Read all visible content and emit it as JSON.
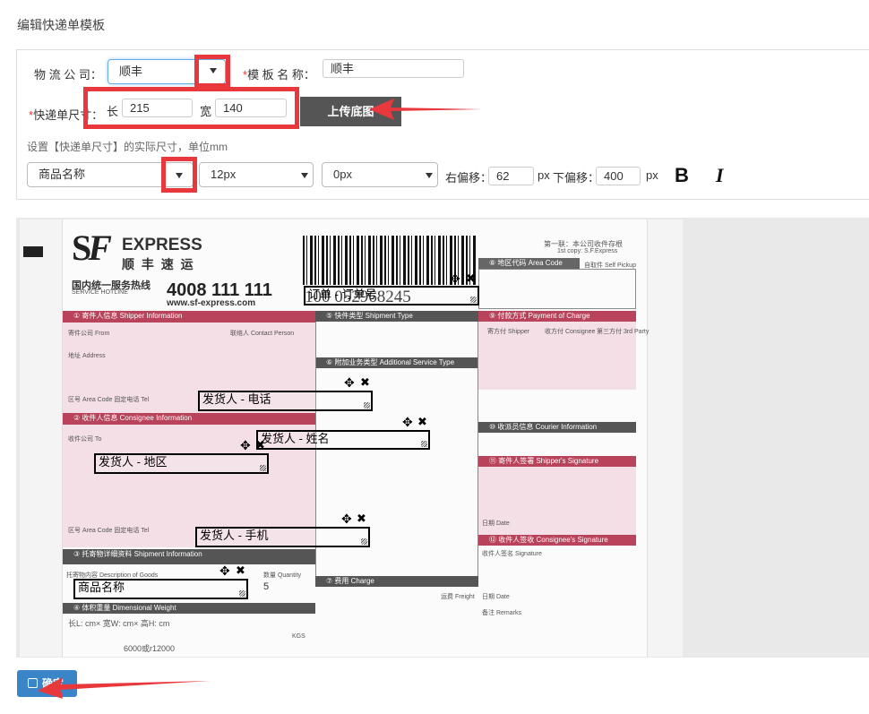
{
  "page_title": "编辑快递单模板",
  "form": {
    "logistics_label": "物 流 公 司：",
    "logistics_value": "顺丰",
    "template_name_label": "模 板 名 称：",
    "template_name_value": "顺丰",
    "size_label": "快递单尺寸：",
    "length_label": "长",
    "length_value": "215",
    "width_label": "宽",
    "width_value": "140",
    "upload_button": "上传底图",
    "size_hint": "设置【快递单尺寸】的实际尺寸，单位mm",
    "field_select": "商品名称",
    "font_size_select": "12px",
    "letter_spacing_select": "0px",
    "right_offset_label": "右偏移：",
    "right_offset_value": "62",
    "right_offset_unit": "px",
    "down_offset_label": "下偏移：",
    "down_offset_value": "400",
    "down_offset_unit": "px",
    "bold_label": "B",
    "italic_label": "I"
  },
  "waybill": {
    "brand": "EXPRESS",
    "brand_cn": "顺 丰 速 运",
    "hotline_cn": "国内统一服务热线",
    "hotline_en": "SERVICE HOTLINE",
    "hotline_number": "4008 111 111",
    "website": "www.sf-express.com",
    "tracking_number": "100 052968245",
    "copy_note": "第一联：本公司收件存根",
    "copy_note_en": "1st copy: S.F.Express",
    "sections": {
      "sender": "① 寄件人信息  Shipper Information",
      "recipient": "② 收件人信息  Consignee Information",
      "goods": "③ 托寄物详细资料  Shipment Information",
      "dimension": "④ 体积重量  Dimensional Weight",
      "shipment_type": "⑤ 快件类型  Shipment Type",
      "additional": "⑥ 附加业务类型  Additional Service Type",
      "fee": "⑦ 费用  Charge",
      "area_code": "⑧ 地区代码  Area Code",
      "payment": "⑨ 付款方式  Payment of Charge",
      "courier": "⑩ 收派员信息  Courier Information",
      "shipper_signature": "⑪ 寄件人签署  Shipper's Signature",
      "consignee_signature": "⑫ 收件人签收  Consignee's Signature"
    },
    "small_labels": {
      "sender_company": "寄件公司 From",
      "contact": "联络人 Contact Person",
      "address": "地址 Address",
      "area_phone": "区号 Area Code   固定电话 Tel",
      "recipient_company": "收件公司 To",
      "pay_shipper": "寄方付 Shipper",
      "pay_consignee": "收方付 Consignee",
      "pay_third": "第三方付 3rd Party",
      "goods_desc": "托寄物内容 Description of Goods",
      "quantity": "数量 Quantity",
      "quantity_value": "5",
      "dims": "长L:      cm× 宽W:      cm× 高H:      cm",
      "kgs": "KGS",
      "formula": "6000或r12000",
      "remarks": "备注 Remarks",
      "date": "日期 Date",
      "signature": "收件人签名 Signature",
      "self_pickup": "自取件 Self Pickup",
      "freight": "运费 Freight"
    },
    "fields": {
      "order_no": "订单 - 订单号",
      "sender_phone": "发货人 - 电话",
      "sender_name": "发货人 - 姓名",
      "sender_area": "发货人 - 地区",
      "sender_mobile": "发货人 - 手机",
      "product_name": "商品名称"
    }
  },
  "confirm_button": "确定",
  "colors": {
    "accent_red": "#e8383c",
    "band_red": "#b8435a",
    "confirm_blue": "#3a85c8",
    "upload_gray": "#555555"
  }
}
